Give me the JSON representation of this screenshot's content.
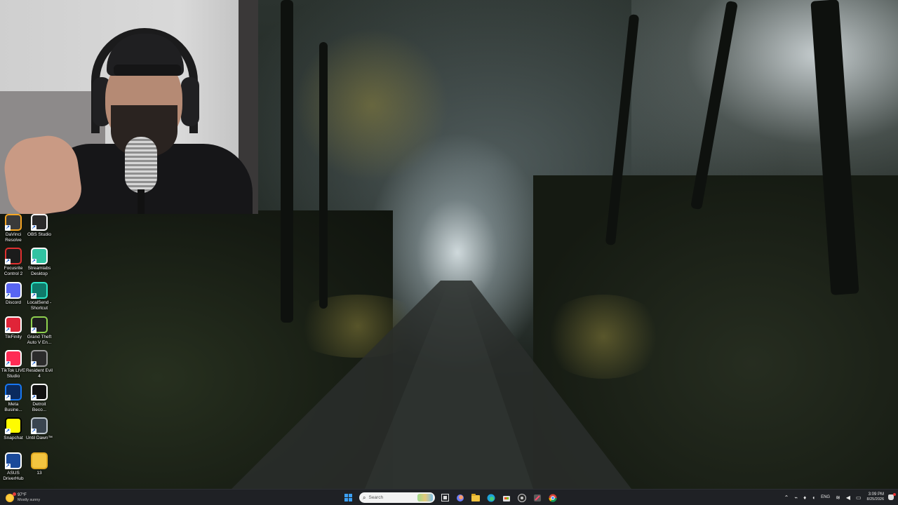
{
  "desktop": {
    "icons": [
      {
        "label": "DaVinci Resolve",
        "icon": "davinci-resolve-icon",
        "color": "#3a3a3a",
        "accent": "#f5a623"
      },
      {
        "label": "OBS Studio",
        "icon": "obs-studio-icon",
        "color": "#2a2a2a",
        "accent": "#ffffff"
      },
      {
        "label": "Focusrite Control 2",
        "icon": "focusrite-icon",
        "color": "#1b1b1b",
        "accent": "#e03030"
      },
      {
        "label": "Streamlabs Desktop",
        "icon": "streamlabs-icon",
        "color": "#31c3a2",
        "accent": "#ffffff"
      },
      {
        "label": "Discord",
        "icon": "discord-icon",
        "color": "#5865f2",
        "accent": "#ffffff"
      },
      {
        "label": "LocalSend - Shortcut",
        "icon": "localsend-icon",
        "color": "#0f7a6b",
        "accent": "#2ee6c8"
      },
      {
        "label": "TikFinity",
        "icon": "tikfinity-icon",
        "color": "#e02438",
        "accent": "#ffffff"
      },
      {
        "label": "Grand Theft Auto V En...",
        "icon": "gta-v-icon",
        "color": "#1e1e1e",
        "accent": "#8fd14f"
      },
      {
        "label": "TikTok LIVE Studio",
        "icon": "tiktok-live-icon",
        "color": "#fe2c55",
        "accent": "#ffffff"
      },
      {
        "label": "Resident Evil 4",
        "icon": "resident-evil-4-icon",
        "color": "#2b2b2b",
        "accent": "#999999"
      },
      {
        "label": "Meta Busine...",
        "icon": "meta-business-icon",
        "color": "#0a2a5e",
        "accent": "#1877f2"
      },
      {
        "label": "Detroit Beco...",
        "icon": "detroit-become-human-icon",
        "color": "#111111",
        "accent": "#ffffff"
      },
      {
        "label": "Snapchat",
        "icon": "snapchat-icon",
        "color": "#fffc00",
        "accent": "#000000"
      },
      {
        "label": "Until Dawn™",
        "icon": "until-dawn-icon",
        "color": "#3a4550",
        "accent": "#c0c8d0"
      },
      {
        "label": "ASUS DriverHub",
        "icon": "asus-driverhub-icon",
        "color": "#1a4a9a",
        "accent": "#ffffff"
      },
      {
        "label": "13",
        "icon": "folder-icon",
        "color": "#f2c440",
        "accent": "#e0a820"
      }
    ]
  },
  "taskbar": {
    "weather": {
      "temp": "97°F",
      "condition": "Mostly sunny"
    },
    "search": {
      "placeholder": "Search"
    },
    "pinned": [
      {
        "name": "task-view-icon"
      },
      {
        "name": "copilot-icon"
      },
      {
        "name": "file-explorer-icon"
      },
      {
        "name": "edge-icon"
      },
      {
        "name": "microsoft-store-icon"
      },
      {
        "name": "obs-taskbar-icon"
      },
      {
        "name": "snipping-tool-icon"
      },
      {
        "name": "chrome-icon"
      }
    ],
    "tray": {
      "language": "ENG",
      "time": "3:09 PM",
      "date": "8/25/2026"
    }
  }
}
